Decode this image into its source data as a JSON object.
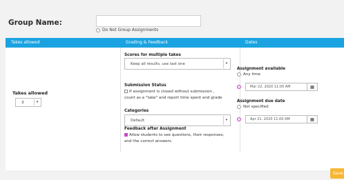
{
  "group": {
    "label": "Group Name:",
    "input_value": "",
    "no_group_label": "Do Not Group Assignments"
  },
  "table": {
    "headers": [
      "Takes allowed",
      "Grading & Feedback",
      "Dates"
    ],
    "header_color": "#1aa3e0"
  },
  "takes": {
    "label": "Takes allowed",
    "value": "3"
  },
  "grading": {
    "scores_label": "Scores for multiple takes",
    "scores_value": "Keep all results, use last one",
    "submission_label": "Submission Status",
    "submission_line1": "If assignment is closed without submission ,",
    "submission_line2": "count as a \"take\" and report time spent and grade",
    "categories_label": "Categories",
    "categories_value": "Default",
    "feedback_label": "Feedback after Assignment",
    "feedback_line1": "Allow students to see questions, their responses,",
    "feedback_line2": "and the correct answers."
  },
  "dates": {
    "available_label": "Assignment available",
    "any_time": "Any time",
    "available_date": "Mar 22, 2020 11:00 AM",
    "due_label": "Assignment due date",
    "not_specified": "Not specified",
    "due_date": "Apr 21, 2020 11:00 AM"
  },
  "actions": {
    "save_label": "Save",
    "save_color": "#f7b733"
  },
  "icons": {
    "calendar": "calendar-icon",
    "caret": "chevron-down-icon"
  }
}
